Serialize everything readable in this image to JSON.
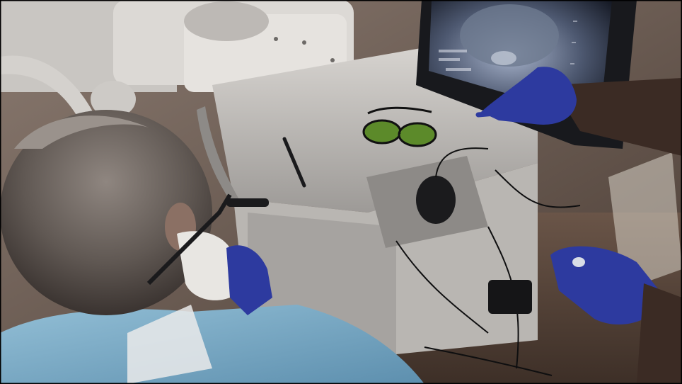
{
  "scene": {
    "kind": "photograph",
    "caption": "",
    "colors": {
      "background_wall": "#7c6c63",
      "equipment_white": "#d7d4d0",
      "gown_blue": "#7fb1cd",
      "glove_blue": "#2d3a9f",
      "monitor_glow": "#8c9ab4",
      "laser_glasses_green": "#5c8a2a",
      "floor_brown": "#5b4a3f"
    },
    "icons": {
      "warning": "laser-warning-icon",
      "eyewear": "safety-glasses-icon"
    }
  }
}
